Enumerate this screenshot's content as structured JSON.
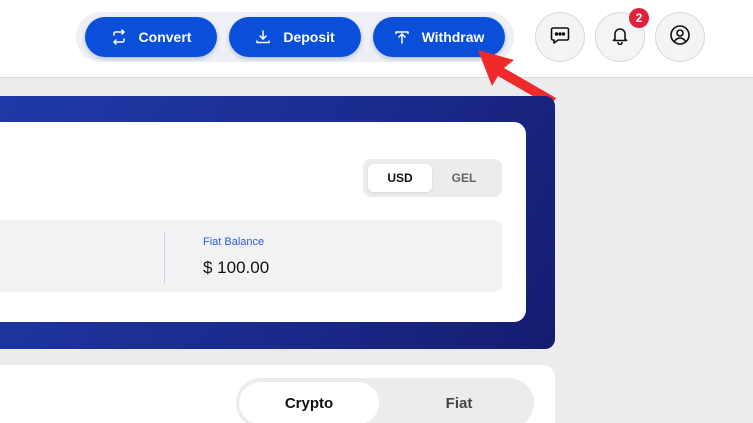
{
  "header": {
    "actions": [
      {
        "label": "Convert",
        "icon": "convert-icon"
      },
      {
        "label": "Deposit",
        "icon": "download-icon"
      },
      {
        "label": "Withdraw",
        "icon": "upload-icon"
      }
    ],
    "notifications_count": "2",
    "icons": [
      "chat-icon",
      "bell-icon",
      "profile-icon"
    ]
  },
  "balance": {
    "currencies": [
      "USD",
      "GEL"
    ],
    "selected_currency": "USD",
    "fiat_label": "Fiat Balance",
    "fiat_value": "$ 100.00"
  },
  "tabs": {
    "items": [
      "Crypto",
      "Fiat"
    ],
    "selected": "Crypto"
  },
  "colors": {
    "accent": "#0a4fd9",
    "panel": "#1b2b8e",
    "badge": "#e0213c",
    "annotation": "#f02a2a"
  }
}
